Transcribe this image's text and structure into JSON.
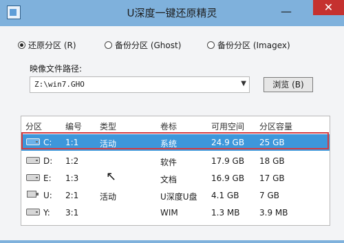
{
  "window": {
    "title": "U深度一键还原精灵",
    "minimize_label": "—",
    "close_label": "✕"
  },
  "options": [
    {
      "label": "还原分区 (R)",
      "checked": true
    },
    {
      "label": "备份分区 (Ghost)",
      "checked": false
    },
    {
      "label": "备份分区 (Imagex)",
      "checked": false
    }
  ],
  "path": {
    "label": "映像文件路径:",
    "value": "Z:\\win7.GHO",
    "browse_label": "浏览 (B)"
  },
  "table": {
    "headers": [
      "分区",
      "编号",
      "类型",
      "卷标",
      "可用空间",
      "分区容量"
    ],
    "rows": [
      {
        "partition": "C:",
        "number": "1:1",
        "type": "活动",
        "label": "系统",
        "free": "24.9 GB",
        "capacity": "25 GB"
      },
      {
        "partition": "D:",
        "number": "1:2",
        "type": "",
        "label": "软件",
        "free": "17.9 GB",
        "capacity": "18 GB"
      },
      {
        "partition": "E:",
        "number": "1:3",
        "type": "",
        "label": "文档",
        "free": "16.9 GB",
        "capacity": "17 GB"
      },
      {
        "partition": "U:",
        "number": "2:1",
        "type": "活动",
        "label": "U深度U盘",
        "free": "4.1 GB",
        "capacity": "7 GB"
      },
      {
        "partition": "Y:",
        "number": "3:1",
        "type": "",
        "label": "WIM",
        "free": "1.3 MB",
        "capacity": "3.9 MB"
      }
    ]
  }
}
